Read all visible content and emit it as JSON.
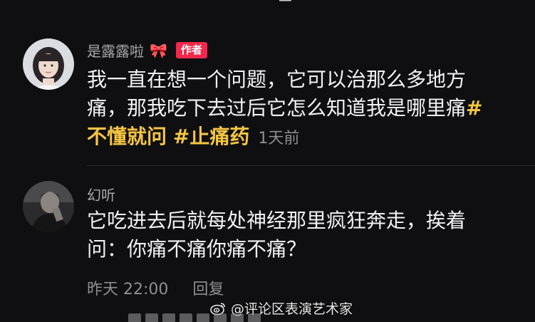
{
  "comments": [
    {
      "username": "是露露啦",
      "user_decoration": "🎀",
      "badge": "作者",
      "text_line1": "我一直在想一个问题，它可以治那么多地方",
      "text_line2_plain": "痛，那我吃下去过后它怎么知道我是哪里痛",
      "text_line2_hashmark": "#",
      "hashtag1": "不懂就问",
      "hashtag2": "#止痛药",
      "time": "1天前"
    },
    {
      "username": "幻听",
      "text_line1": "它吃进去后就每处神经那里疯狂奔走，挨着",
      "text_line2": "问：你痛不痛你痛不痛？",
      "time": "昨天 22:00",
      "reply_label": "回复"
    }
  ],
  "watermark": "@评论区表演艺术家",
  "icons": {
    "avatar1": "avatar-girl-icon",
    "avatar2": "avatar-man-icon",
    "watermark": "weibo-icon"
  },
  "colors": {
    "background": "#0f0f11",
    "hashtag": "#f5c542",
    "author_badge": "#f3284c",
    "secondary_text": "#8e8e93"
  }
}
